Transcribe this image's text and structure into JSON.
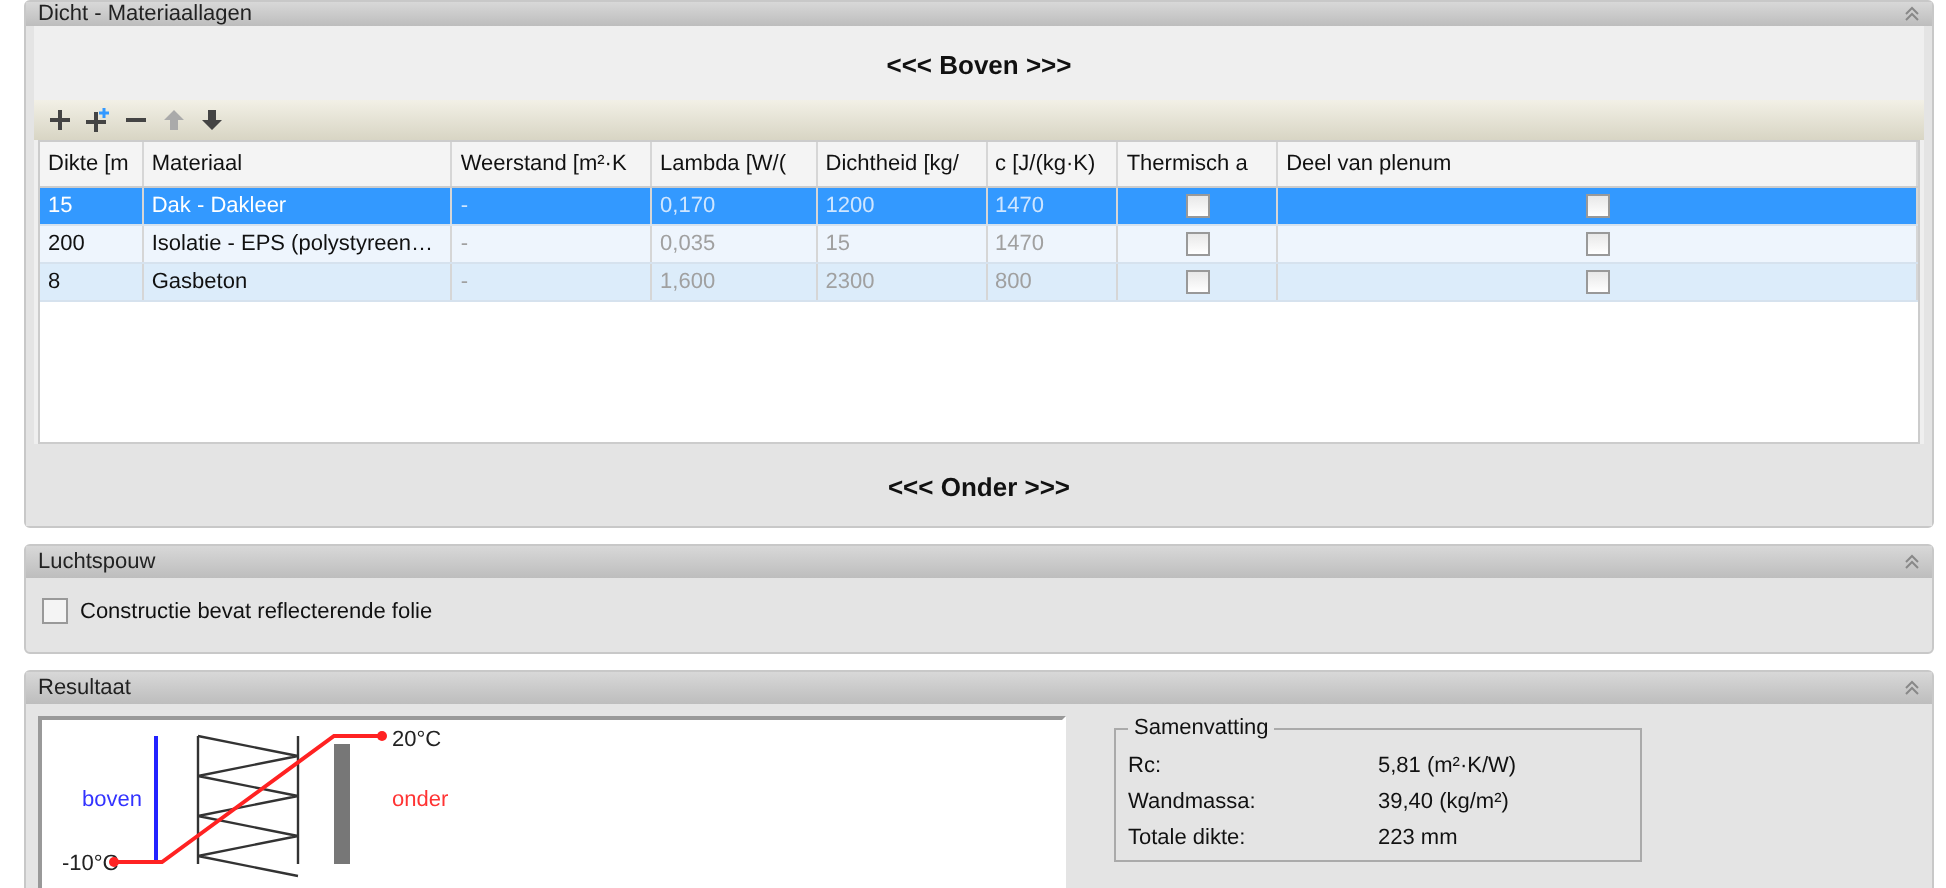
{
  "layers_panel": {
    "title": "Dicht - Materiaallagen",
    "top_label": "<<< Boven >>>",
    "bottom_label": "<<< Onder >>>",
    "toolbar": [
      {
        "kind": "add",
        "disabled": false
      },
      {
        "kind": "insert",
        "disabled": false
      },
      {
        "kind": "remove",
        "disabled": false
      },
      {
        "kind": "up",
        "disabled": true
      },
      {
        "kind": "down",
        "disabled": false
      }
    ],
    "columns": [
      {
        "label": "Dikte [m",
        "greyed": false
      },
      {
        "label": "Materiaal",
        "greyed": false
      },
      {
        "label": "Weerstand [m²·K",
        "greyed": true
      },
      {
        "label": "Lambda [W/(",
        "greyed": true
      },
      {
        "label": "Dichtheid [kg/",
        "greyed": true
      },
      {
        "label": "c [J/(kg·K)",
        "greyed": true
      },
      {
        "label": "Thermisch a",
        "greyed": false
      },
      {
        "label": "Deel van plenum",
        "greyed": false
      }
    ],
    "rows": [
      {
        "selected": true,
        "dikte": "15",
        "materiaal": "Dak - Dakleer",
        "weerstand": "-",
        "lambda": "0,170",
        "dichtheid": "1200",
        "c": "1470",
        "thermisch": false,
        "plenum": false
      },
      {
        "selected": false,
        "dikte": "200",
        "materiaal": "Isolatie - EPS (polystyreen…",
        "weerstand": "-",
        "lambda": "0,035",
        "dichtheid": "15",
        "c": "1470",
        "thermisch": false,
        "plenum": false
      },
      {
        "selected": false,
        "dikte": "8",
        "materiaal": "Gasbeton",
        "weerstand": "-",
        "lambda": "1,600",
        "dichtheid": "2300",
        "c": "800",
        "thermisch": false,
        "plenum": false
      }
    ]
  },
  "air_panel": {
    "title": "Luchtspouw",
    "checkbox": {
      "label": "Constructie bevat reflecterende folie",
      "checked": false
    }
  },
  "result_panel": {
    "title": "Resultaat",
    "diagram": {
      "top_label": "boven",
      "bottom_label": "onder",
      "warm_temp": "20°C",
      "cold_temp": "-10°C"
    },
    "summary": {
      "title": "Samenvatting",
      "rows": [
        {
          "label": "Rc:",
          "value": "5,81 (m²·K/W)"
        },
        {
          "label": "Wandmassa:",
          "value": "39,40 (kg/m²)"
        },
        {
          "label": "Totale dikte:",
          "value": "223 mm"
        }
      ]
    }
  }
}
